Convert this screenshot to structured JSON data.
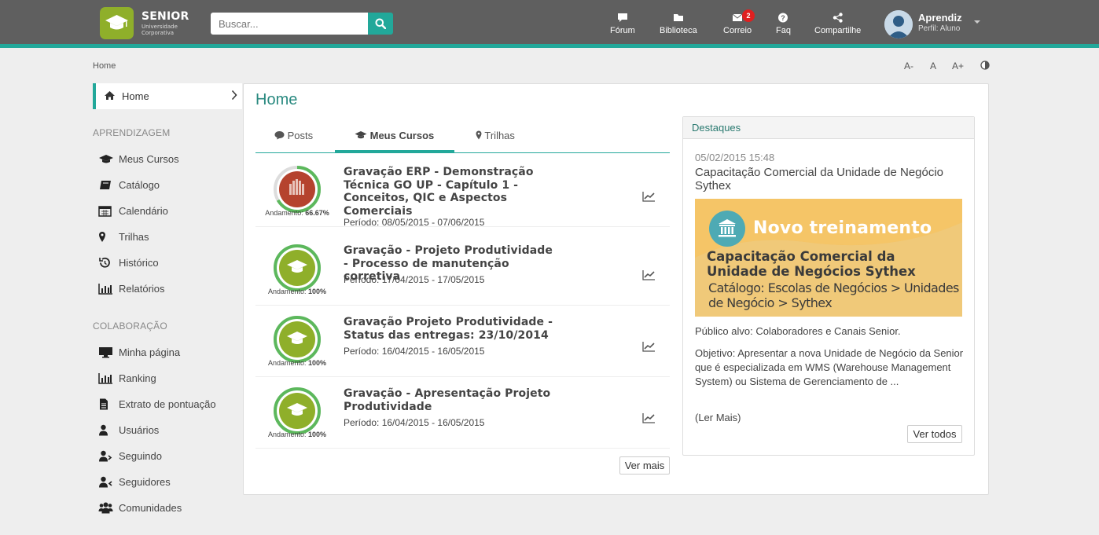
{
  "brand": {
    "title": "SENIOR",
    "subtitle": "Universidade Corporativa"
  },
  "search": {
    "placeholder": "Buscar..."
  },
  "nav": [
    {
      "label": "Fórum",
      "icon": "comment-icon"
    },
    {
      "label": "Biblioteca",
      "icon": "folder-icon"
    },
    {
      "label": "Correio",
      "icon": "envelope-icon",
      "badge": "2"
    },
    {
      "label": "Faq",
      "icon": "question-icon"
    },
    {
      "label": "Compartilhe",
      "icon": "share-icon"
    }
  ],
  "user": {
    "name": "Aprendiz",
    "role": "Perfil: Aluno"
  },
  "breadcrumb": "Home",
  "font_controls": [
    "A-",
    "A",
    "A+"
  ],
  "sidebar": {
    "home": "Home",
    "section1": "APRENDIZAGEM",
    "items1": [
      {
        "label": "Meus Cursos",
        "icon": "graduation-cap-icon"
      },
      {
        "label": "Catálogo",
        "icon": "book-icon"
      },
      {
        "label": "Calendário",
        "icon": "calendar-icon"
      },
      {
        "label": "Trilhas",
        "icon": "map-marker-icon"
      },
      {
        "label": "Histórico",
        "icon": "history-icon"
      },
      {
        "label": "Relatórios",
        "icon": "bar-chart-icon"
      }
    ],
    "section2": "COLABORAÇÃO",
    "items2": [
      {
        "label": "Minha página",
        "icon": "monitor-icon"
      },
      {
        "label": "Ranking",
        "icon": "bar-chart-icon"
      },
      {
        "label": "Extrato de pontuação",
        "icon": "document-icon"
      },
      {
        "label": "Usuários",
        "icon": "user-icon"
      },
      {
        "label": "Seguindo",
        "icon": "user-follow-icon"
      },
      {
        "label": "Seguidores",
        "icon": "user-followers-icon"
      },
      {
        "label": "Comunidades",
        "icon": "group-icon"
      }
    ]
  },
  "main": {
    "title": "Home",
    "tabs": [
      {
        "label": "Posts",
        "icon": "comment-icon"
      },
      {
        "label": "Meus Cursos",
        "icon": "graduation-cap-icon"
      },
      {
        "label": "Trilhas",
        "icon": "map-marker-icon"
      }
    ],
    "courses": [
      {
        "title": "Gravação ERP - Demonstração Técnica GO UP - Capítulo 1 - Conceitos, QIC e Aspectos Comerciais",
        "period": "Período: 08/05/2015 - 07/06/2015",
        "progress_label": "Andamento:",
        "progress_value": "66.67%",
        "progress": 0.6667,
        "badge_color": "#b5432e",
        "badge_icon": "equalizer-icon"
      },
      {
        "title": "Gravação - Projeto Produtividade - Processo de manutenção corretiva",
        "period": "Período: 17/04/2015 - 17/05/2015",
        "progress_label": "Andamento:",
        "progress_value": "100%",
        "progress": 1.0,
        "badge_color": "#8faf2a",
        "badge_icon": "graduation-cap-icon"
      },
      {
        "title": "Gravação Projeto Produtividade - Status das entregas: 23/10/2014",
        "period": "Período: 16/04/2015 - 16/05/2015",
        "progress_label": "Andamento:",
        "progress_value": "100%",
        "progress": 1.0,
        "badge_color": "#8faf2a",
        "badge_icon": "graduation-cap-icon"
      },
      {
        "title": "Gravação - Apresentação Projeto Produtividade",
        "period": "Período: 16/04/2015 - 16/05/2015",
        "progress_label": "Andamento:",
        "progress_value": "100%",
        "progress": 1.0,
        "badge_color": "#8faf2a",
        "badge_icon": "graduation-cap-icon"
      }
    ],
    "more_button": "Ver mais"
  },
  "highlights": {
    "heading": "Destaques",
    "date": "05/02/2015 15:48",
    "title": "Capacitação Comercial da Unidade de Negócio Sythex",
    "banner": {
      "head": "Novo treinamento",
      "title": "Capacitação Comercial da Unidade de Negócios Sythex",
      "catalog": "Catálogo: Escolas de Negócios > Unidades de Negócio > Sythex"
    },
    "audience": "Público alvo: Colaboradores e Canais Senior.",
    "objective": "Objetivo: Apresentar a nova Unidade de Negócio da Senior que é especializada em WMS (Warehouse Management System) ou Sistema de Gerenciamento de ...",
    "read_more": "(Ler Mais)",
    "all_button": "Ver todos"
  },
  "colors": {
    "accent": "#22a89a",
    "header": "#5f5f5f",
    "progress_ring": "#5cb85c"
  }
}
